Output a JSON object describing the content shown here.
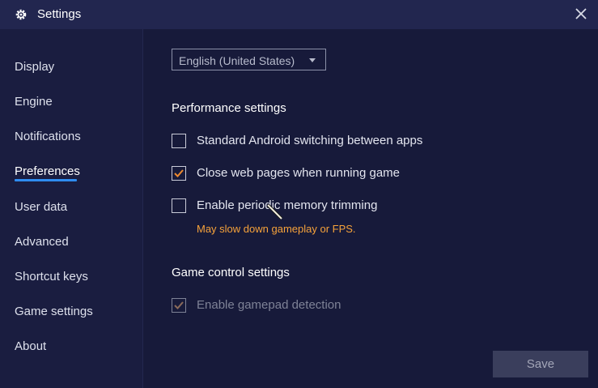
{
  "titlebar": {
    "title": "Settings",
    "icon": "gear-icon",
    "close_icon": "close-icon"
  },
  "sidebar": {
    "items": [
      {
        "label": "Display"
      },
      {
        "label": "Engine"
      },
      {
        "label": "Notifications"
      },
      {
        "label": "Preferences",
        "active": true
      },
      {
        "label": "User data"
      },
      {
        "label": "Advanced"
      },
      {
        "label": "Shortcut keys"
      },
      {
        "label": "Game settings"
      },
      {
        "label": "About"
      }
    ],
    "accent": "#2f8cf0"
  },
  "language": {
    "selected": "English (United States)"
  },
  "performance": {
    "title": "Performance settings",
    "options": [
      {
        "label": "Standard Android switching between apps",
        "checked": false
      },
      {
        "label": "Close web pages when running game",
        "checked": true
      },
      {
        "label": "Enable periodic memory trimming",
        "checked": false
      }
    ],
    "warning": "May slow down gameplay or FPS.",
    "warning_color": "#f6a23a"
  },
  "game_control": {
    "title": "Game control settings",
    "options": [
      {
        "label": "Enable gamepad detection",
        "checked": true,
        "disabled": true
      }
    ]
  },
  "footer": {
    "save_label": "Save"
  }
}
